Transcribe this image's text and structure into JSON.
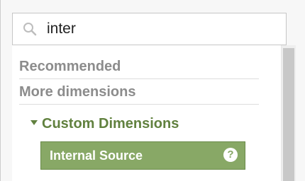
{
  "search": {
    "value": "inter",
    "icon": "search-icon"
  },
  "sections": {
    "recommended": "Recommended",
    "more_dimensions": "More dimensions"
  },
  "group": {
    "label": "Custom Dimensions",
    "expanded": true,
    "icon": "caret-down-icon"
  },
  "selected_item": {
    "label": "Internal Source",
    "help_glyph": "?",
    "help_icon": "help-icon"
  },
  "colors": {
    "accent_green": "#88a866",
    "group_text": "#61813f",
    "header_text": "#8c8c8c"
  }
}
